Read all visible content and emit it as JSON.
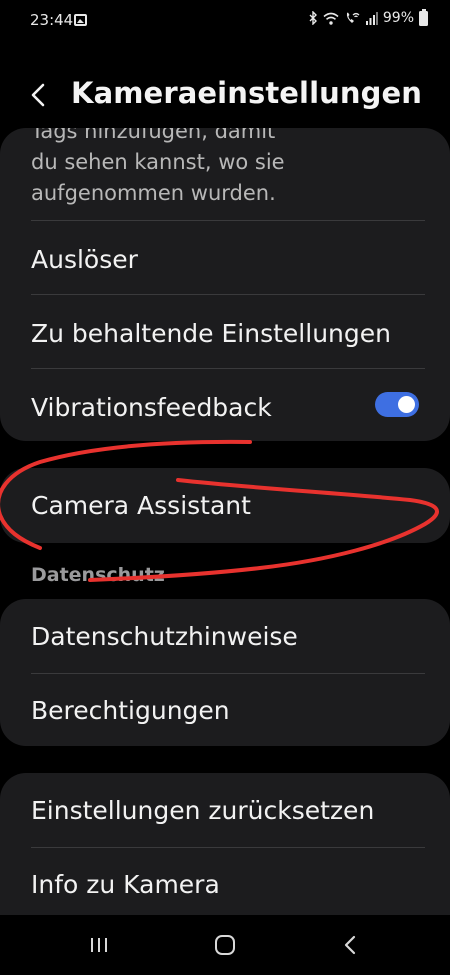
{
  "status_bar": {
    "time": "23:44",
    "battery": "99%",
    "icons": [
      "gallery-icon",
      "bluetooth-icon",
      "wifi-icon",
      "wifi-calling-icon",
      "signal-icon",
      "battery-icon"
    ]
  },
  "header": {
    "title": "Kameraeinstellungen",
    "back_icon": "chevron-left-icon"
  },
  "card1": {
    "partial_text_line0": "Tags hinzufügen, damit",
    "partial_text_line1": "du sehen kannst, wo sie",
    "partial_text_line2": "aufgenommen wurden.",
    "items": [
      {
        "label": "Auslöser"
      },
      {
        "label": "Zu behaltende Einstellungen"
      },
      {
        "label": "Vibrationsfeedback",
        "toggle_on": true
      }
    ]
  },
  "card2": {
    "items": [
      {
        "label": "Camera Assistant"
      }
    ]
  },
  "privacy": {
    "section_label": "Datenschutz",
    "items": [
      {
        "label": "Datenschutzhinweise"
      },
      {
        "label": "Berechtigungen"
      }
    ]
  },
  "card4": {
    "items": [
      {
        "label": "Einstellungen zurücksetzen"
      },
      {
        "label": "Info zu Kamera"
      }
    ]
  },
  "navbar": {
    "icons": [
      "recents-icon",
      "home-icon",
      "back-icon"
    ]
  },
  "colors": {
    "background": "#000000",
    "card": "#1c1c1e",
    "toggle_accent": "#3e6fe2",
    "annotation": "#e8322e"
  }
}
